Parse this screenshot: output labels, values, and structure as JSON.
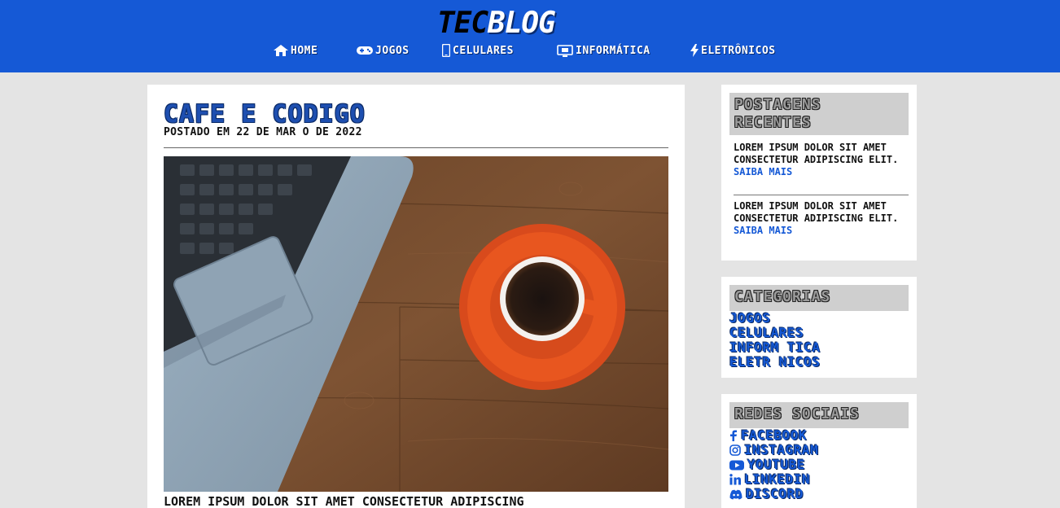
{
  "header": {
    "logo_part1": "TEC",
    "logo_part2": "BLOG",
    "nav": [
      {
        "label": "HOME",
        "icon": "home-icon"
      },
      {
        "label": "JOGOS",
        "icon": "gamepad-icon"
      },
      {
        "label": "CELULARES",
        "icon": "smartphone-icon"
      },
      {
        "label": "INFORMÁTICA",
        "icon": "laptop-icon"
      },
      {
        "label": "ELETRÔNICOS",
        "icon": "lightning-icon"
      }
    ]
  },
  "article": {
    "title": "CAFE E CODIGO",
    "date": "POSTADO EM 22 DE MAR O DE 2022",
    "image_alt": "laptop and coffee cup",
    "excerpt": "LOREM IPSUM DOLOR SIT AMET  CONSECTETUR ADIPISCING"
  },
  "sidebar": {
    "recent": {
      "title": "POSTAGENS RECENTES",
      "posts": [
        {
          "text": "LOREM IPSUM DOLOR SIT AMET  CONSECTETUR ADIPISCING ELIT.",
          "link": "SAIBA MAIS"
        },
        {
          "text": "LOREM IPSUM DOLOR SIT AMET  CONSECTETUR ADIPISCING ELIT.",
          "link": "SAIBA MAIS"
        }
      ]
    },
    "categories": {
      "title": "CATEGORIAS",
      "items": [
        "JOGOS",
        "CELULARES",
        "INFORM TICA",
        "ELETR NICOS"
      ]
    },
    "social": {
      "title": "REDES SOCIAIS",
      "items": [
        {
          "label": "FACEBOOK",
          "icon": "facebook-icon"
        },
        {
          "label": "INSTAGRAM",
          "icon": "instagram-icon"
        },
        {
          "label": "YOUTUBE",
          "icon": "youtube-icon"
        },
        {
          "label": "LINKEDIN",
          "icon": "linkedin-icon"
        },
        {
          "label": "DISCORD",
          "icon": "discord-icon"
        }
      ]
    }
  },
  "colors": {
    "header_blue": "#1559d6",
    "page_bg": "#e4e4e4",
    "widget_title_bg": "#cfcfcf"
  }
}
